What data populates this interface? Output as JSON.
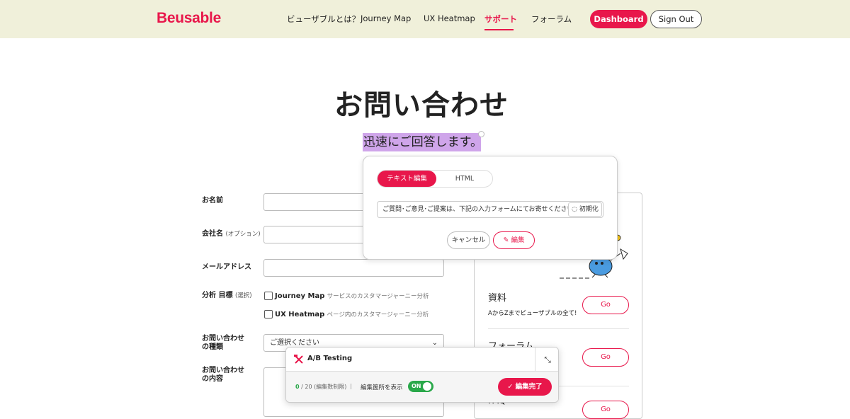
{
  "brand": {
    "name": "Beusable",
    "accent": "#e8174b"
  },
  "nav": {
    "items": [
      "ビューザブルとは？",
      "Journey Map",
      "UX Heatmap",
      "サポート",
      "フォーラム"
    ],
    "active": "サポート",
    "dashboard": "Dashboard",
    "sign_out": "Sign Out"
  },
  "page": {
    "title": "お問い合わせ",
    "subtitle": "迅速にご回答します。"
  },
  "editor_popup": {
    "tabs": [
      "テキスト編集",
      "HTML"
    ],
    "active_tab": "テキスト編集",
    "text_value": "ご質問･ご意見･ご提案は、下記の入力フォームにてお寄せください。",
    "reset_label": "初期化",
    "cancel_label": "キャンセル",
    "edit_label": "編集"
  },
  "form": {
    "name_label": "お名前",
    "company_label": "会社名",
    "company_optional": "(オプション)",
    "email_label": "メールアドレス",
    "goal_label": "分析 目標",
    "goal_optional": "(選択)",
    "goal_options": [
      {
        "name": "Journey Map",
        "desc": "サービスのカスタマージャーニー分析"
      },
      {
        "name": "UX Heatmap",
        "desc": "ページ内のカスタマージャーニー分析"
      }
    ],
    "type_label_1": "お問い合わせ",
    "type_label_2": "の種類",
    "type_placeholder": "ご選択ください",
    "content_label_1": "お問い合わせ",
    "content_label_2": "の内容"
  },
  "side_card": {
    "items": [
      {
        "title": "資料",
        "desc": "AからZまでビューザブルの全て!",
        "go": "Go"
      },
      {
        "title": "フォーラム",
        "desc": "",
        "go": "Go"
      },
      {
        "title": "FAQ",
        "desc": "",
        "go": "Go"
      }
    ]
  },
  "ab_panel": {
    "title": "A/B Testing",
    "count_current": "0",
    "count_rest": "/ 20 (編集数制限)",
    "separator": "|",
    "show_label": "編集箇所を表示",
    "toggle_state": "ON",
    "done_label": "編集完了"
  }
}
